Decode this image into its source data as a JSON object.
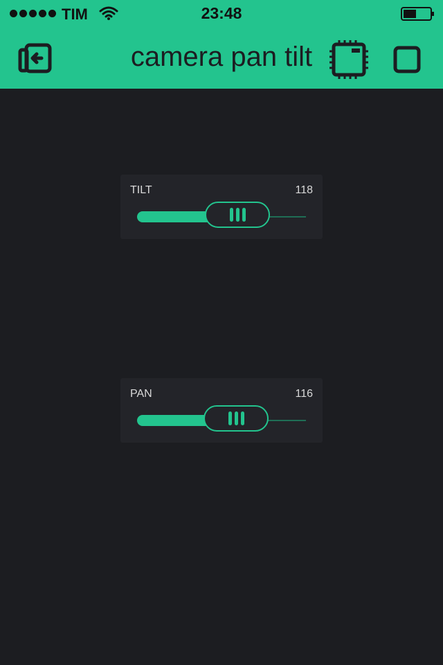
{
  "status_bar": {
    "carrier": "TIM",
    "time": "23:48",
    "signal_bars": 5,
    "battery_level": 0.45
  },
  "header": {
    "title": "camera pan tilt",
    "back_icon": "exit-project-icon",
    "device_icon": "device-chip-icon",
    "play_icon": "play-stop-square-icon"
  },
  "sliders": [
    {
      "label": "TILT",
      "value": "118",
      "fill_fraction": 0.5
    },
    {
      "label": "PAN",
      "value": "116",
      "fill_fraction": 0.49
    }
  ],
  "colors": {
    "accent": "#23c48e",
    "background": "#1c1d21",
    "widget": "#232429",
    "track": "#1f6e55",
    "text": "#d9d9d9"
  }
}
